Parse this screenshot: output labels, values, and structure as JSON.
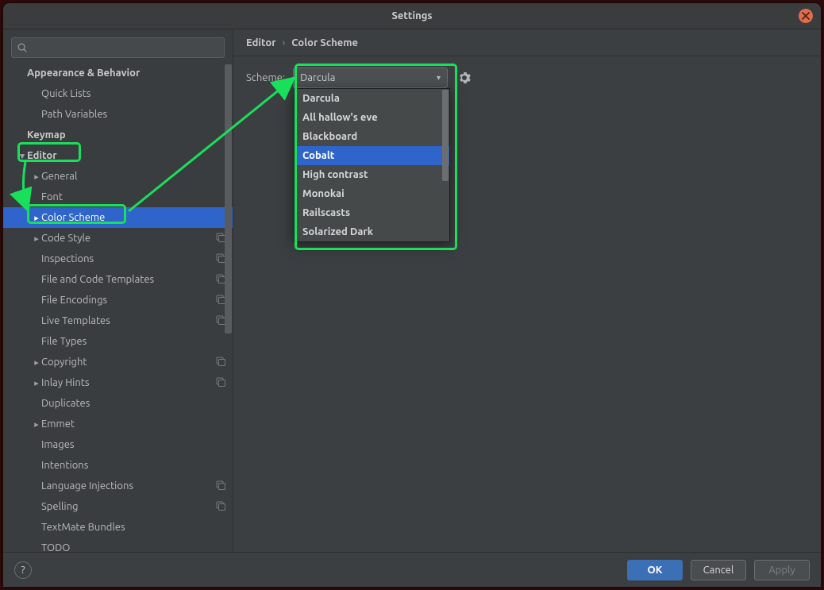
{
  "window": {
    "title": "Settings"
  },
  "sidebar": {
    "search_placeholder": "",
    "items": [
      {
        "label": "Appearance & Behavior",
        "indent": 0,
        "bold": true,
        "arrow": ""
      },
      {
        "label": "Quick Lists",
        "indent": 1,
        "bold": false,
        "arrow": ""
      },
      {
        "label": "Path Variables",
        "indent": 1,
        "bold": false,
        "arrow": ""
      },
      {
        "label": "Keymap",
        "indent": 0,
        "bold": true,
        "arrow": ""
      },
      {
        "label": "Editor",
        "indent": 0,
        "bold": true,
        "arrow": "down"
      },
      {
        "label": "General",
        "indent": 1,
        "bold": false,
        "arrow": "right"
      },
      {
        "label": "Font",
        "indent": 1,
        "bold": false,
        "arrow": ""
      },
      {
        "label": "Color Scheme",
        "indent": 1,
        "bold": false,
        "arrow": "right",
        "selected": true
      },
      {
        "label": "Code Style",
        "indent": 1,
        "bold": false,
        "arrow": "right",
        "badge": true
      },
      {
        "label": "Inspections",
        "indent": 1,
        "bold": false,
        "arrow": "",
        "badge": true
      },
      {
        "label": "File and Code Templates",
        "indent": 1,
        "bold": false,
        "arrow": "",
        "badge": true
      },
      {
        "label": "File Encodings",
        "indent": 1,
        "bold": false,
        "arrow": "",
        "badge": true
      },
      {
        "label": "Live Templates",
        "indent": 1,
        "bold": false,
        "arrow": "",
        "badge": true
      },
      {
        "label": "File Types",
        "indent": 1,
        "bold": false,
        "arrow": ""
      },
      {
        "label": "Copyright",
        "indent": 1,
        "bold": false,
        "arrow": "right",
        "badge": true
      },
      {
        "label": "Inlay Hints",
        "indent": 1,
        "bold": false,
        "arrow": "right",
        "badge": true
      },
      {
        "label": "Duplicates",
        "indent": 1,
        "bold": false,
        "arrow": ""
      },
      {
        "label": "Emmet",
        "indent": 1,
        "bold": false,
        "arrow": "right"
      },
      {
        "label": "Images",
        "indent": 1,
        "bold": false,
        "arrow": ""
      },
      {
        "label": "Intentions",
        "indent": 1,
        "bold": false,
        "arrow": ""
      },
      {
        "label": "Language Injections",
        "indent": 1,
        "bold": false,
        "arrow": "",
        "badge": true
      },
      {
        "label": "Spelling",
        "indent": 1,
        "bold": false,
        "arrow": "",
        "badge": true
      },
      {
        "label": "TextMate Bundles",
        "indent": 1,
        "bold": false,
        "arrow": ""
      },
      {
        "label": "TODO",
        "indent": 1,
        "bold": false,
        "arrow": ""
      }
    ]
  },
  "breadcrumb": {
    "part1": "Editor",
    "sep": "›",
    "part2": "Color Scheme"
  },
  "scheme": {
    "label": "Scheme:",
    "selected": "Darcula",
    "options": [
      "Darcula",
      "All hallow's eve",
      "Blackboard",
      "Cobalt",
      "High contrast",
      "Monokai",
      "Railscasts",
      "Solarized Dark"
    ],
    "highlighted_index": 3
  },
  "footer": {
    "help": "?",
    "ok": "OK",
    "cancel": "Cancel",
    "apply": "Apply"
  }
}
